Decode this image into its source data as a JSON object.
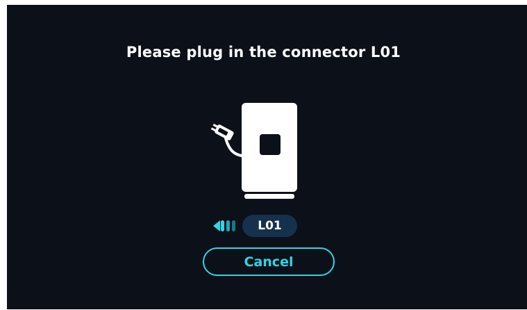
{
  "instruction": {
    "title": "Please plug in the connector L01"
  },
  "connector": {
    "label": "L01"
  },
  "actions": {
    "cancel_label": "Cancel"
  },
  "colors": {
    "screen_background": "#0b1019",
    "accent": "#2fd6e6",
    "pill_background": "#16314d",
    "illustration": "#ffffff"
  },
  "icons": {
    "charger": "ev-charger-icon",
    "plug": "plug-icon",
    "direction": "arrow-left-icon"
  }
}
